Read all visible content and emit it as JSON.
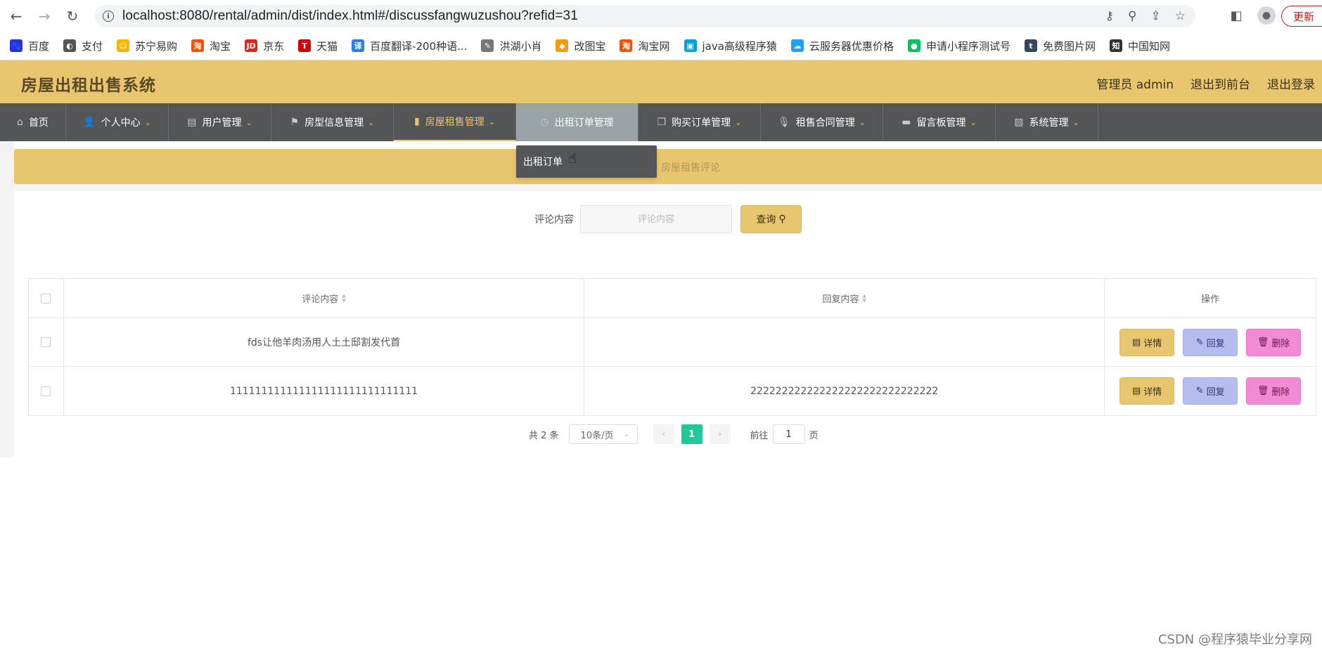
{
  "browser": {
    "url": "localhost:8080/rental/admin/dist/index.html#/discussfangwuzushou?refid=31",
    "update_label": "更新",
    "bookmarks": [
      {
        "label": "百度",
        "color": "#2932e1",
        "glyph": "🐾"
      },
      {
        "label": "支付",
        "color": "#555555",
        "glyph": "◐"
      },
      {
        "label": "苏宁易购",
        "color": "#f5b400",
        "glyph": "☺"
      },
      {
        "label": "淘宝",
        "color": "#ff5000",
        "glyph": "淘"
      },
      {
        "label": "京东",
        "color": "#e1251b",
        "glyph": "JD"
      },
      {
        "label": "天猫",
        "color": "#d00000",
        "glyph": "T"
      },
      {
        "label": "百度翻译-200种语...",
        "color": "#2f7de1",
        "glyph": "译"
      },
      {
        "label": "洪湖小肖",
        "color": "#777777",
        "glyph": "✎"
      },
      {
        "label": "改图宝",
        "color": "#f39c12",
        "glyph": "◆"
      },
      {
        "label": "淘宝网",
        "color": "#ff5000",
        "glyph": "淘"
      },
      {
        "label": "java高级程序猿",
        "color": "#00a1d6",
        "glyph": "▣"
      },
      {
        "label": "云服务器优惠价格",
        "color": "#20a0ff",
        "glyph": "☁"
      },
      {
        "label": "申请小程序测试号",
        "color": "#07c160",
        "glyph": "●"
      },
      {
        "label": "免费图片网",
        "color": "#34495e",
        "glyph": "t"
      },
      {
        "label": "中国知网",
        "color": "#333333",
        "glyph": "知"
      }
    ]
  },
  "header": {
    "title": "房屋出租出售系统",
    "admin_label": "管理员 admin",
    "front_label": "退出到前台",
    "logout_label": "退出登录"
  },
  "nav": [
    {
      "label": "首页",
      "icon": "home-icon",
      "glyph": "⌂",
      "caret": false
    },
    {
      "label": "个人中心",
      "icon": "user-icon",
      "glyph": "👤",
      "caret": true
    },
    {
      "label": "用户管理",
      "icon": "briefcase-icon",
      "glyph": "▤",
      "caret": true
    },
    {
      "label": "房型信息管理",
      "icon": "flag-icon",
      "glyph": "⚑",
      "caret": true
    },
    {
      "label": "房屋租售管理",
      "icon": "bar-chart-icon",
      "glyph": "▮",
      "caret": true
    },
    {
      "label": "出租订单管理",
      "icon": "clock-icon",
      "glyph": "◷",
      "caret": false
    },
    {
      "label": "购买订单管理",
      "icon": "copy-icon",
      "glyph": "❐",
      "caret": true
    },
    {
      "label": "租售合同管理",
      "icon": "microphone-icon",
      "glyph": "🎙",
      "caret": true
    },
    {
      "label": "留言板管理",
      "icon": "printer-icon",
      "glyph": "▬",
      "caret": true
    },
    {
      "label": "系统管理",
      "icon": "chart-icon",
      "glyph": "▨",
      "caret": true
    }
  ],
  "dropdown": {
    "item": "出租订单"
  },
  "breadcrumb": {
    "text": "房屋租售评论"
  },
  "search": {
    "label": "评论内容",
    "placeholder": "评论内容",
    "button_label": "查询"
  },
  "table": {
    "headers": {
      "content": "评论内容",
      "reply": "回复内容",
      "ops": "操作"
    },
    "rows": [
      {
        "content": "fds让他羊肉汤用人土土邸割发代首",
        "reply": ""
      },
      {
        "content": "111111111111111111111111111111",
        "reply": "222222222222222222222222222222"
      }
    ],
    "buttons": {
      "detail": "详情",
      "reply": "回复",
      "delete": "删除"
    }
  },
  "pagination": {
    "total": "共 2 条",
    "page_size": "10条/页",
    "current_page": "1",
    "goto_label": "前往",
    "goto_value": "1",
    "page_suffix": "页"
  },
  "watermark": "CSDN @程序猿毕业分享网"
}
